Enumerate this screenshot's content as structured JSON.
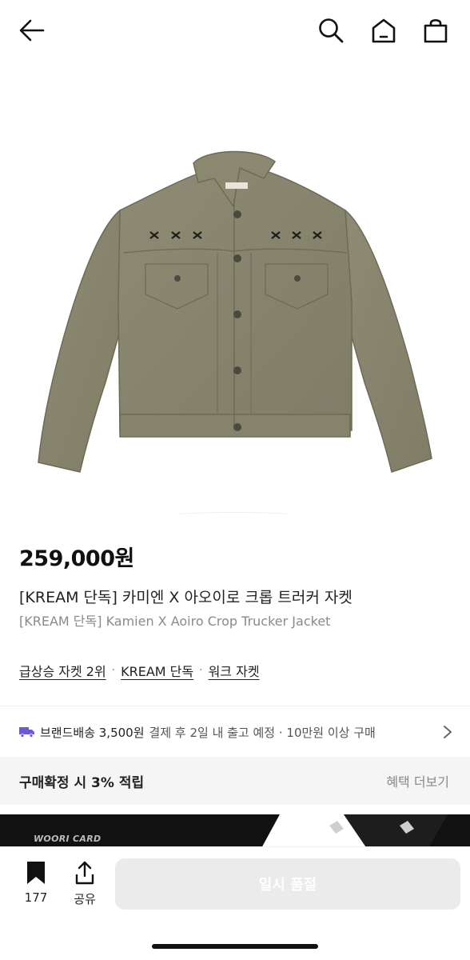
{
  "header": {
    "back_icon": "arrow-left-icon",
    "search_icon": "search-icon",
    "home_icon": "home-icon",
    "shop_icon": "shopping-bag-icon"
  },
  "product": {
    "image": "olive-trucker-jacket",
    "price": "259,000원",
    "title_ko": "[KREAM 단독] 카미엔 X 아오이로 크롭 트러커 자켓",
    "title_en": "[KREAM 단독] Kamien X Aoiro Crop Trucker Jacket"
  },
  "tags": [
    {
      "label": "급상승 자켓 2위"
    },
    {
      "label": "KREAM 단독"
    },
    {
      "label": "워크 자켓"
    }
  ],
  "tag_separator": "·",
  "shipping": {
    "strong": "브랜드배송 3,500원",
    "muted": "결제 후 2일 내 출고 예정 · 10만원 이상 구매",
    "icon": "truck-icon",
    "accent": "#6b5bd6"
  },
  "reward": {
    "label": "구매확정 시 3% 적립",
    "link": "혜택 더보기"
  },
  "banner": {
    "label": "WOORI CARD"
  },
  "bottom": {
    "bookmark_count": "177",
    "share_label": "공유",
    "buy_label": "일시 품절"
  }
}
